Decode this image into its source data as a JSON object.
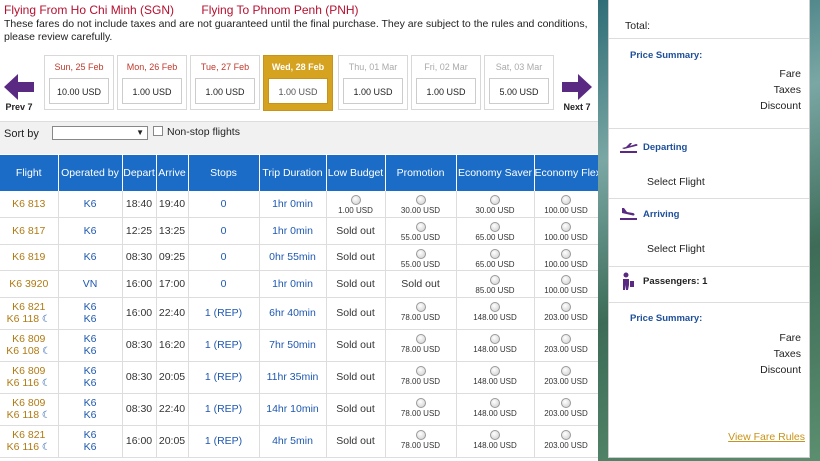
{
  "header": {
    "from": "Flying From Ho Chi Minh (SGN)",
    "to": "Flying To Phnom Penh (PNH)",
    "disclaimer": "These fares do not include taxes and are not guaranteed until the final purchase. They are subject to the rules and conditions, please review carefully."
  },
  "nav": {
    "prev": "Prev 7",
    "next": "Next 7"
  },
  "dates": [
    {
      "label": "Sun, 25 Feb",
      "price": "10.00 USD"
    },
    {
      "label": "Mon, 26 Feb",
      "price": "1.00 USD"
    },
    {
      "label": "Tue, 27 Feb",
      "price": "1.00 USD"
    },
    {
      "label": "Wed, 28 Feb",
      "price": "1.00 USD",
      "selected": true
    },
    {
      "label": "Thu, 01 Mar",
      "price": "1.00 USD"
    },
    {
      "label": "Fri, 02 Mar",
      "price": "1.00 USD"
    },
    {
      "label": "Sat, 03 Mar",
      "price": "5.00 USD"
    }
  ],
  "sort": {
    "label": "Sort by",
    "value": "",
    "nonstop_label": "Non-stop flights"
  },
  "table": {
    "headers": [
      "Flight",
      "Operated by",
      "Depart",
      "Arrive",
      "Stops",
      "Trip Duration",
      "Low Budget",
      "Promotion",
      "Economy Saver",
      "Economy Flex"
    ],
    "rows": [
      {
        "flight": [
          "K6 813"
        ],
        "op": [
          "K6"
        ],
        "depart": "18:40",
        "arrive": "19:40",
        "stops": "0",
        "duration": "1hr 0min",
        "fares": [
          "1.00 USD",
          "30.00 USD",
          "30.00 USD",
          "100.00 USD"
        ]
      },
      {
        "flight": [
          "K6 817"
        ],
        "op": [
          "K6"
        ],
        "depart": "12:25",
        "arrive": "13:25",
        "stops": "0",
        "duration": "1hr 0min",
        "fares": [
          "Sold out",
          "55.00 USD",
          "65.00 USD",
          "100.00 USD"
        ]
      },
      {
        "flight": [
          "K6 819"
        ],
        "op": [
          "K6"
        ],
        "depart": "08:30",
        "arrive": "09:25",
        "stops": "0",
        "duration": "0hr 55min",
        "fares": [
          "Sold out",
          "55.00 USD",
          "65.00 USD",
          "100.00 USD"
        ]
      },
      {
        "flight": [
          "K6 3920"
        ],
        "op": [
          "VN"
        ],
        "depart": "16:00",
        "arrive": "17:00",
        "stops": "0",
        "duration": "1hr 0min",
        "fares": [
          "Sold out",
          "Sold out",
          "85.00 USD",
          "100.00 USD"
        ]
      },
      {
        "flight": [
          "K6 821",
          "K6 118"
        ],
        "op": [
          "K6",
          "K6"
        ],
        "depart": "16:00",
        "arrive": "22:40",
        "stops": "1 (REP)",
        "duration": "6hr 40min",
        "fares": [
          "Sold out",
          "78.00 USD",
          "148.00 USD",
          "203.00 USD"
        ]
      },
      {
        "flight": [
          "K6 809",
          "K6 108"
        ],
        "op": [
          "K6",
          "K6"
        ],
        "depart": "08:30",
        "arrive": "16:20",
        "stops": "1 (REP)",
        "duration": "7hr 50min",
        "fares": [
          "Sold out",
          "78.00 USD",
          "148.00 USD",
          "203.00 USD"
        ]
      },
      {
        "flight": [
          "K6 809",
          "K6 116"
        ],
        "op": [
          "K6",
          "K6"
        ],
        "depart": "08:30",
        "arrive": "20:05",
        "stops": "1 (REP)",
        "duration": "11hr 35min",
        "fares": [
          "Sold out",
          "78.00 USD",
          "148.00 USD",
          "203.00 USD"
        ]
      },
      {
        "flight": [
          "K6 809",
          "K6 118"
        ],
        "op": [
          "K6",
          "K6"
        ],
        "depart": "08:30",
        "arrive": "22:40",
        "stops": "1 (REP)",
        "duration": "14hr 10min",
        "fares": [
          "Sold out",
          "78.00 USD",
          "148.00 USD",
          "203.00 USD"
        ]
      },
      {
        "flight": [
          "K6 821",
          "K6 116"
        ],
        "op": [
          "K6",
          "K6"
        ],
        "depart": "16:00",
        "arrive": "20:05",
        "stops": "1 (REP)",
        "duration": "4hr 5min",
        "fares": [
          "Sold out",
          "78.00 USD",
          "148.00 USD",
          "203.00 USD"
        ]
      }
    ]
  },
  "sidebar": {
    "total_label": "Total:",
    "summary1_title": "Price Summary:",
    "fare": "Fare",
    "taxes": "Taxes",
    "discount": "Discount",
    "departing": "Departing",
    "departing_select": "Select Flight",
    "arriving": "Arriving",
    "arriving_select": "Select Flight",
    "passengers": "Passengers: 1",
    "summary2_title": "Price Summary:",
    "fare2": "Fare",
    "taxes2": "Taxes",
    "discount2": "Discount",
    "rules_link": "View Fare Rules"
  },
  "icons": {
    "prev": "arrow-left-icon",
    "next": "arrow-right-icon",
    "overnight": "moon-icon",
    "departing": "plane-takeoff-icon",
    "arriving": "plane-landing-icon",
    "passengers": "traveler-icon"
  },
  "colors": {
    "brand_gold": "#d6a320",
    "header_blue": "#1a6cc6",
    "route_red": "#b5102f",
    "arrow_purple": "#5a2a82"
  }
}
